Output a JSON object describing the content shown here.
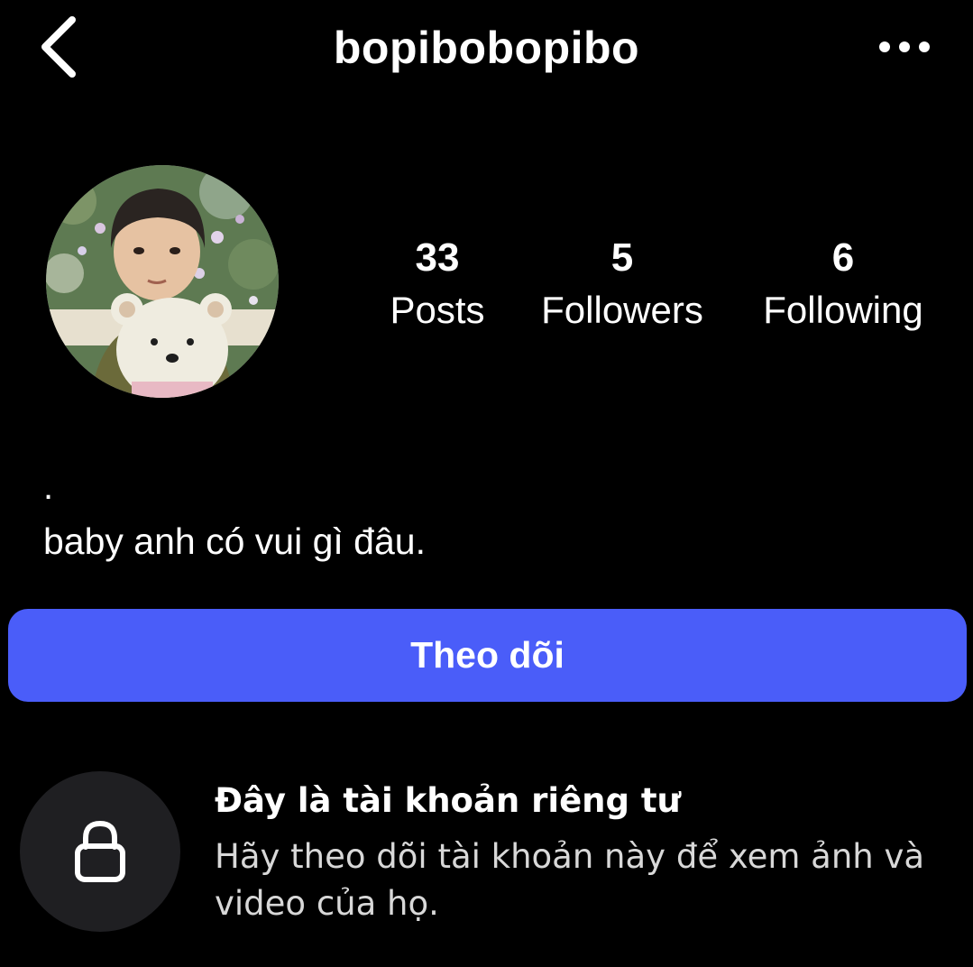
{
  "header": {
    "back_icon": "chevron-left-icon",
    "username": "bopibobopibo",
    "more_icon": "more-horizontal-icon"
  },
  "profile": {
    "avatar": "profile-photo",
    "stats": {
      "posts": {
        "count": "33",
        "label": "Posts"
      },
      "followers": {
        "count": "5",
        "label": "Followers"
      },
      "following": {
        "count": "6",
        "label": "Following"
      }
    },
    "bio_line1": ".",
    "bio_line2": "baby anh có vui gì đâu."
  },
  "actions": {
    "follow_label": "Theo dõi",
    "follow_color": "#4a5df9"
  },
  "private_notice": {
    "icon": "lock-icon",
    "title": "Đây là tài khoản riêng tư",
    "description": "Hãy theo dõi tài khoản này để xem ảnh và video của họ."
  }
}
